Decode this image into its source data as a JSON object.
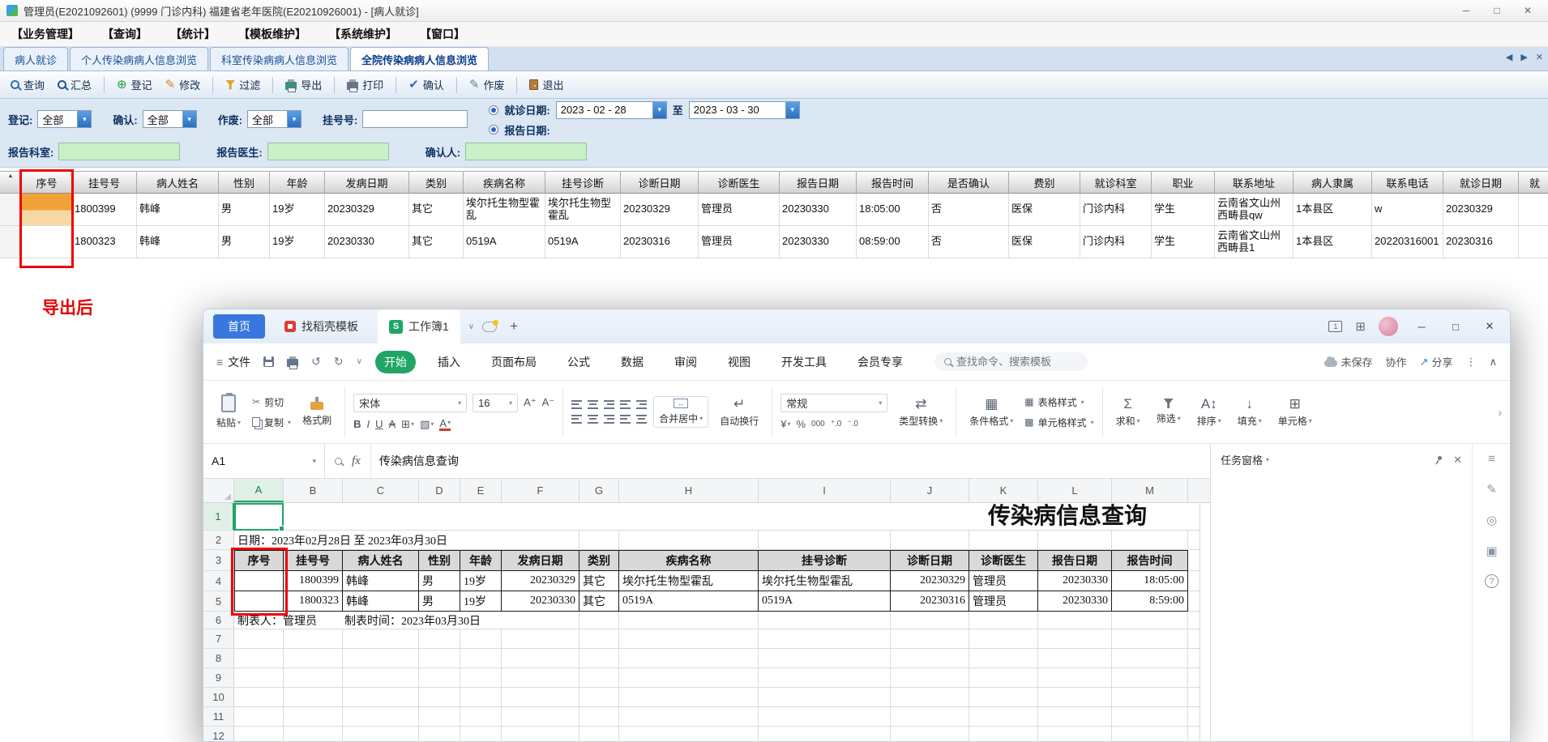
{
  "window": {
    "title": "管理员(E2021092601) (9999 门诊内科) 福建省老年医院(E20210926001) - [病人就诊]",
    "min": "─",
    "max": "□",
    "close": "✕"
  },
  "menubar": {
    "items": [
      "【业务管理】",
      "【查询】",
      "【统计】",
      "【模板维护】",
      "【系统维护】",
      "【窗口】"
    ]
  },
  "tabbar": {
    "tabs": [
      "病人就诊",
      "个人传染病病人信息浏览",
      "科室传染病病人信息浏览",
      "全院传染病病人信息浏览"
    ],
    "prev": "◀",
    "next": "▶",
    "close": "✕"
  },
  "toolbar": {
    "items": [
      "查询",
      "汇总",
      "登记",
      "修改",
      "过滤",
      "导出",
      "打印",
      "确认",
      "作废",
      "退出"
    ]
  },
  "filters": {
    "register_label": "登记:",
    "register_value": "全部",
    "confirm_label": "确认:",
    "confirm_value": "全部",
    "invalid_label": "作废:",
    "invalid_value": "全部",
    "regno_label": "挂号号:",
    "regno_value": "",
    "visit_date_label": "就诊日期:",
    "report_date_label": "报告日期:",
    "date_from": "2023 - 02 - 28",
    "to_label": "至",
    "date_to": "2023 - 03 - 30",
    "dept_label": "报告科室:",
    "dept_value": "",
    "doctor_label": "报告医生:",
    "doctor_value": "",
    "confirmer_label": "确认人:",
    "confirmer_value": ""
  },
  "grid": {
    "columns": [
      "序号",
      "挂号号",
      "病人姓名",
      "性别",
      "年龄",
      "发病日期",
      "类别",
      "疾病名称",
      "挂号诊断",
      "诊断日期",
      "诊断医生",
      "报告日期",
      "报告时间",
      "是否确认",
      "费别",
      "就诊科室",
      "职业",
      "联系地址",
      "病人隶属",
      "联系电话",
      "就诊日期",
      "就"
    ],
    "rows": [
      [
        "",
        "1800399",
        "韩峰",
        "男",
        "19岁",
        "20230329",
        "其它",
        "埃尔托生物型霍乱",
        "埃尔托生物型霍乱",
        "20230329",
        "管理员",
        "20230330",
        "18:05:00",
        "否",
        "医保",
        "门诊内科",
        "学生",
        "云南省文山州西畴县qw",
        "1本县区",
        "w",
        "20230329",
        ""
      ],
      [
        "",
        "1800323",
        "韩峰",
        "男",
        "19岁",
        "20230330",
        "其它",
        "0519A",
        "0519A",
        "20230316",
        "管理员",
        "20230330",
        "08:59:00",
        "否",
        "医保",
        "门诊内科",
        "学生",
        "云南省文山州西畴县1",
        "1本县区",
        "20220316001",
        "20230316",
        ""
      ]
    ]
  },
  "annotation": {
    "label": "导出后"
  },
  "wps": {
    "tabbar": {
      "home": "首页",
      "docer_tab": "找稻壳模板",
      "workbook_tab": "工作簿1",
      "new_tab": "+",
      "min": "─",
      "max": "□",
      "close": "✕"
    },
    "menubar": {
      "file": "文件",
      "ribbon_tabs": [
        "开始",
        "插入",
        "页面布局",
        "公式",
        "数据",
        "审阅",
        "视图",
        "开发工具",
        "会员专享"
      ],
      "search_placeholder": "查找命令、搜索模板",
      "save_status": "未保存",
      "collaborate": "协作",
      "share": "分享"
    },
    "ribbon": {
      "paste": "粘贴",
      "cut": "剪切",
      "copy": "复制",
      "format_painter": "格式刷",
      "font_name": "宋体",
      "font_size": "16",
      "merge_center": "合并居中",
      "wrap_text": "自动换行",
      "number_format": "常规",
      "type_convert": "类型转换",
      "conditional_format": "条件格式",
      "table_style": "表格样式",
      "cell_style": "单元格样式",
      "sum": "求和",
      "filter": "筛选",
      "sort": "排序",
      "fill": "填充",
      "cells": "单元格"
    },
    "formula_bar": {
      "name_box": "A1",
      "fx": "fx",
      "content": "传染病信息查询"
    },
    "sheet": {
      "col_headers": [
        "A",
        "B",
        "C",
        "D",
        "E",
        "F",
        "G",
        "H",
        "I",
        "J",
        "K",
        "L",
        "M"
      ],
      "row_numbers": [
        "1",
        "2",
        "3",
        "4",
        "5",
        "6",
        "7",
        "8",
        "9",
        "10",
        "11",
        "12"
      ],
      "title": "传染病信息查询",
      "date_line": "日期：2023年02月28日 至 2023年03月30日",
      "footer_left": "制表人：管理员",
      "footer_right": "制表时间：2023年03月30日",
      "table_rows": [
        {
          "head": "3",
          "cells": [
            "序号",
            "挂号号",
            "病人姓名",
            "性别",
            "年龄",
            "发病日期",
            "类别",
            "疾病名称",
            "挂号诊断",
            "诊断日期",
            "诊断医生",
            "报告日期",
            "报告时间"
          ]
        },
        {
          "head": "4",
          "cells": [
            "",
            "1800399",
            "韩峰",
            "男",
            "19岁",
            "20230329",
            "其它",
            "埃尔托生物型霍乱",
            "埃尔托生物型霍乱",
            "20230329",
            "管理员",
            "20230330",
            "18:05:00"
          ]
        },
        {
          "head": "5",
          "cells": [
            "",
            "1800323",
            "韩峰",
            "男",
            "19岁",
            "20230330",
            "其它",
            "0519A",
            "0519A",
            "20230316",
            "管理员",
            "20230330",
            "8:59:00"
          ]
        }
      ]
    },
    "task_pane": {
      "title": "任务窗格"
    }
  }
}
